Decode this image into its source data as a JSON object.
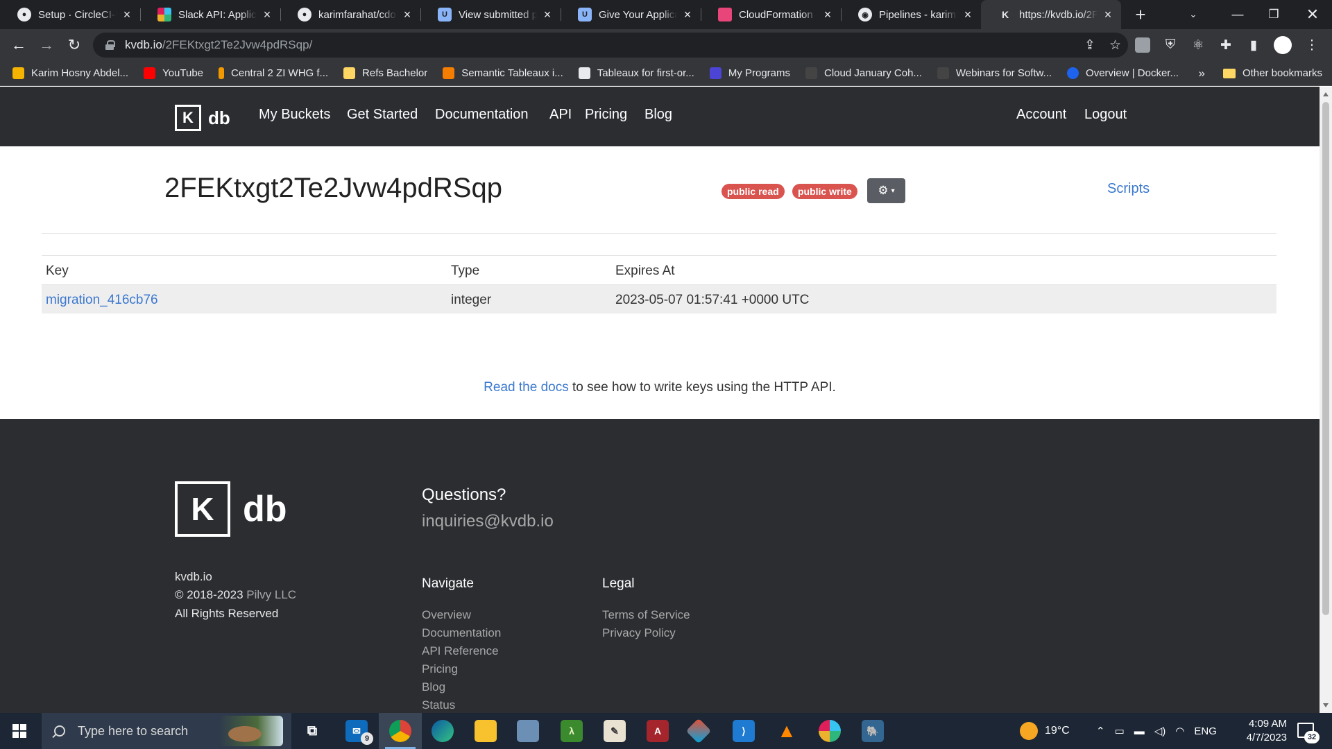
{
  "browser": {
    "tabs": [
      {
        "title": "Setup · CircleCI-P",
        "icon": "github-icon",
        "color": "#e8eaed"
      },
      {
        "title": "Slack API: Applica",
        "icon": "slack-icon",
        "color": "#e8eaed"
      },
      {
        "title": "karimfarahat/cdo",
        "icon": "github-icon",
        "color": "#e8eaed"
      },
      {
        "title": "View submitted p",
        "icon": "udacity-icon",
        "color": "#8ab4f8"
      },
      {
        "title": "Give Your Applica",
        "icon": "udacity-icon",
        "color": "#8ab4f8"
      },
      {
        "title": "CloudFormation -",
        "icon": "cloudformation-icon",
        "color": "#e8457a"
      },
      {
        "title": "Pipelines - karimf",
        "icon": "circleci-icon",
        "color": "#e8eaed"
      },
      {
        "title": "https://kvdb.io/2F",
        "icon": "kvdb-icon",
        "color": "#e8eaed"
      }
    ],
    "address": {
      "host": "kvdb.io",
      "path": "/2FEKtxgt2Te2Jvw4pdRSqp/"
    },
    "bookmarks": [
      {
        "label": "Karim Hosny Abdel...",
        "color": "#f4b400"
      },
      {
        "label": "YouTube",
        "color": "#ff0000"
      },
      {
        "label": "Central 2 ZI WHG f...",
        "color": "#f29900"
      },
      {
        "label": "Refs Bachelor",
        "color": "#fdd663"
      },
      {
        "label": "Semantic Tableaux i...",
        "color": "#f57d00"
      },
      {
        "label": "Tableaux for first-or...",
        "color": "#b31b1b"
      },
      {
        "label": "My Programs",
        "color": "#4c44d4"
      },
      {
        "label": "Cloud January Coh...",
        "color": "#444444"
      },
      {
        "label": "Webinars for Softw...",
        "color": "#444444"
      },
      {
        "label": "Overview | Docker...",
        "color": "#1d63ed"
      }
    ],
    "bookmarks_more": "»",
    "other_bookmarks": "Other bookmarks"
  },
  "site": {
    "logo_k": "K",
    "logo_db": "db",
    "nav": [
      "My Buckets",
      "Get Started",
      "Documentation",
      "API",
      "Pricing",
      "Blog"
    ],
    "account": "Account",
    "logout": "Logout",
    "bucket_id": "2FEKtxgt2Te2Jvw4pdRSqp",
    "badges": [
      "public read",
      "public write"
    ],
    "scripts": "Scripts",
    "table": {
      "headers": [
        "Key",
        "Type",
        "Expires At"
      ],
      "rows": [
        {
          "key": "migration_416cb76",
          "type": "integer",
          "expires": "2023-05-07 01:57:41 +0000 UTC"
        }
      ]
    },
    "docs_link": "Read the docs",
    "docs_rest": " to see how to write keys using the HTTP API."
  },
  "footer": {
    "site": "kvdb.io",
    "copyright": "© 2018-2023",
    "company": "Pilvy LLC",
    "rights": "All Rights Reserved",
    "questions": "Questions?",
    "email": "inquiries@kvdb.io",
    "navigate_heading": "Navigate",
    "navigate_links": [
      "Overview",
      "Documentation",
      "API Reference",
      "Pricing",
      "Blog",
      "Status"
    ],
    "legal_heading": "Legal",
    "legal_links": [
      "Terms of Service",
      "Privacy Policy"
    ]
  },
  "taskbar": {
    "search_placeholder": "Type here to search",
    "mail_badge": "9",
    "weather": "19°C",
    "language": "ENG",
    "time": "4:09 AM",
    "date": "4/7/2023",
    "notification_count": "32"
  }
}
